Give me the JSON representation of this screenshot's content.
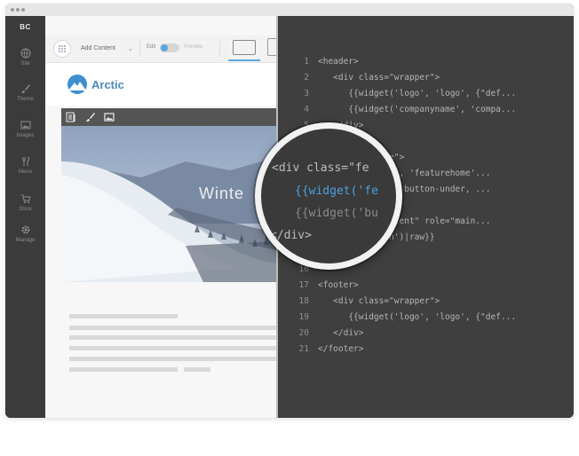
{
  "sidebar": {
    "brand": "BC",
    "items": [
      {
        "label": "Site",
        "icon": "globe-icon"
      },
      {
        "label": "Theme",
        "icon": "brush-icon"
      },
      {
        "label": "Images",
        "icon": "image-icon"
      },
      {
        "label": "Menu",
        "icon": "fork-knife-icon"
      },
      {
        "label": "Store",
        "icon": "cart-icon"
      },
      {
        "label": "Manage",
        "icon": "gear-icon"
      }
    ]
  },
  "toolbar": {
    "add_content": "Add Content",
    "edit_label": "Edit",
    "preview_label": "Preview",
    "edit_mode_on": true
  },
  "site": {
    "logo_text": "Arctic",
    "hero_title": "Winte"
  },
  "code": {
    "lines": [
      {
        "n": "1",
        "text": "<header>"
      },
      {
        "n": "2",
        "text": "   <div class=\"wrapper\">"
      },
      {
        "n": "3",
        "text": "      {{widget('logo', 'logo', {\"def..."
      },
      {
        "n": "4",
        "text": "      {{widget('companyname', 'compa..."
      },
      {
        "n": "5",
        "text": "   </div>"
      },
      {
        "n": "",
        "text": ""
      },
      {
        "n": "",
        "text": "        feature\">"
      },
      {
        "n": "",
        "text": "        feature', 'featurehome'..."
      },
      {
        "n": "",
        "text": "        button', button-under, ..."
      },
      {
        "n": "",
        "text": ""
      },
      {
        "n": "",
        "text": "      \"main-content\" role=\"main..."
      },
      {
        "n": "14",
        "text": "   {{zone('main')|raw}}"
      },
      {
        "n": "15",
        "text": "</div>"
      },
      {
        "n": "16",
        "text": ""
      },
      {
        "n": "17",
        "text": "<footer>"
      },
      {
        "n": "18",
        "text": "   <div class=\"wrapper\">"
      },
      {
        "n": "19",
        "text": "      {{widget('logo', 'logo', {\"def..."
      },
      {
        "n": "20",
        "text": "   </div>"
      },
      {
        "n": "21",
        "text": "</footer>"
      }
    ]
  },
  "magnifier": {
    "line1": "<div class=\"fe",
    "line2a": "{{widget('fe",
    "line3": "{{widget('bu",
    "line4": "</div>"
  },
  "colors": {
    "accent": "#5aa6dc",
    "code_bg": "#3f3f3f",
    "sidebar_bg": "#3b3b3b",
    "widget_bar": "#555555",
    "highlight_code": "#4aa0e0"
  }
}
